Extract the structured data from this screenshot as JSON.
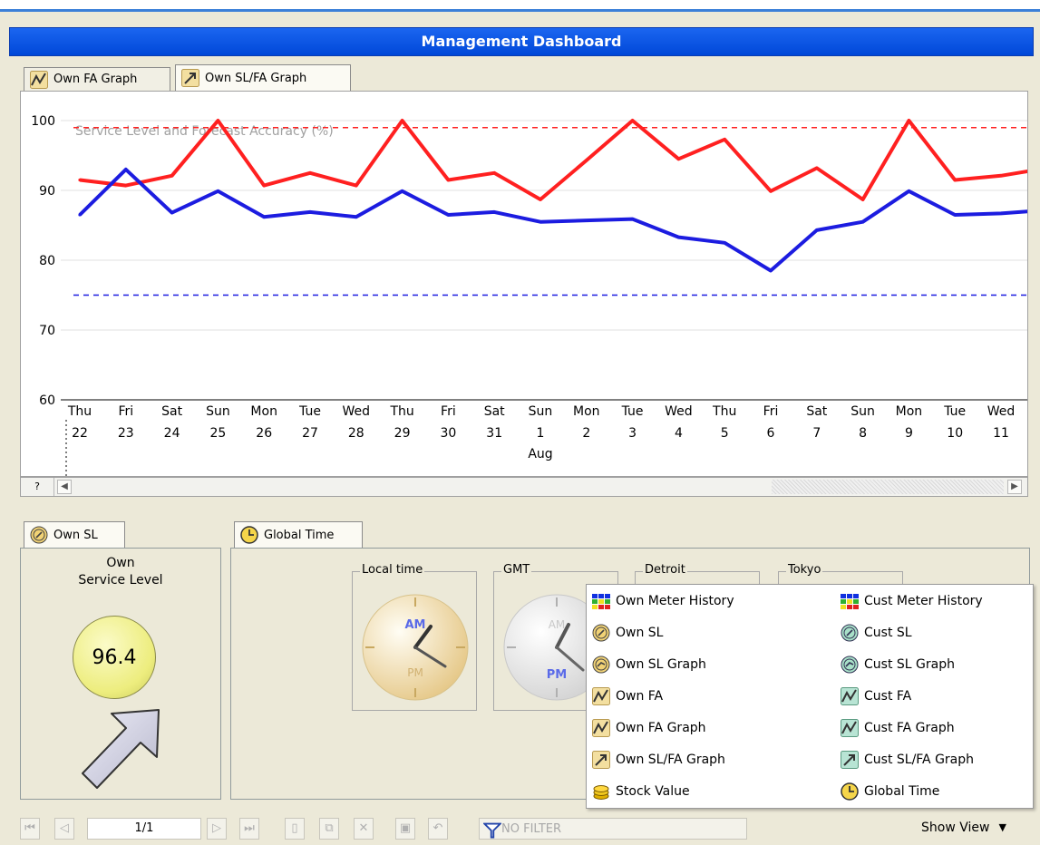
{
  "window": {
    "title": "Management Dashboard"
  },
  "top_tabs": [
    {
      "label": "Own FA Graph",
      "icon": "own-fa-graph-icon"
    },
    {
      "label": "Own SL/FA Graph",
      "icon": "own-slfa-graph-icon"
    }
  ],
  "chart": {
    "help_label": "?"
  },
  "chart_data": {
    "type": "line",
    "title": "Service Level and Forecast Accuracy (%)",
    "xlabel": "",
    "ylabel": "",
    "ylim": [
      60,
      100
    ],
    "yticks": [
      60,
      70,
      80,
      90,
      100
    ],
    "grid": true,
    "categories": [
      "Thu 22",
      "Fri 23",
      "Sat 24",
      "Sun 25",
      "Mon 26",
      "Tue 27",
      "Wed 28",
      "Thu 29",
      "Fri 30",
      "Sat 31",
      "Sun 1",
      "Mon 2",
      "Tue 3",
      "Wed 4",
      "Thu 5",
      "Fri 6",
      "Sat 7",
      "Sun 8",
      "Mon 9",
      "Tue 10",
      "Wed 11"
    ],
    "x_days": [
      "Thu",
      "Fri",
      "Sat",
      "Sun",
      "Mon",
      "Tue",
      "Wed",
      "Thu",
      "Fri",
      "Sat",
      "Sun",
      "Mon",
      "Tue",
      "Wed",
      "Thu",
      "Fri",
      "Sat",
      "Sun",
      "Mon",
      "Tue",
      "Wed"
    ],
    "x_dates": [
      "22",
      "23",
      "24",
      "25",
      "26",
      "27",
      "28",
      "29",
      "30",
      "31",
      "1",
      "2",
      "3",
      "4",
      "5",
      "6",
      "7",
      "8",
      "9",
      "10",
      "11"
    ],
    "month_label": "Aug",
    "series": [
      {
        "color": "#ff2020",
        "values": [
          91.5,
          90.7,
          92.1,
          100,
          90.7,
          92.5,
          90.7,
          100,
          91.5,
          92.5,
          88.7,
          94.3,
          100,
          94.5,
          97.3,
          89.9,
          93.2,
          88.7,
          100,
          91.5,
          92.1,
          93.2
        ]
      },
      {
        "color": "#1c1ce0",
        "values": [
          86.5,
          93.0,
          86.8,
          89.9,
          86.2,
          86.9,
          86.2,
          89.9,
          86.5,
          86.9,
          85.5,
          85.7,
          85.9,
          83.3,
          82.5,
          78.5,
          84.3,
          85.5,
          89.9,
          86.5,
          86.7,
          87.2
        ]
      }
    ],
    "reference_lines": [
      {
        "value": 99,
        "color": "#ff2020",
        "style": "dashed"
      },
      {
        "value": 75,
        "color": "#1c1ce0",
        "style": "dashed"
      }
    ]
  },
  "left_panel": {
    "tab_label": "Own SL",
    "label_line1": "Own",
    "label_line2": "Service Level",
    "value": "96.4",
    "indicator_color": "#f1f17a",
    "trend": "up"
  },
  "global_time": {
    "tab_label": "Global Time",
    "clocks": [
      {
        "label": "Local time"
      },
      {
        "label": "GMT"
      },
      {
        "label": "Detroit"
      },
      {
        "label": "Tokyo"
      }
    ],
    "am_label": "AM",
    "pm_label": "PM"
  },
  "show_view_menu": {
    "left_items": [
      {
        "label": "Own Meter History",
        "icon": "meter-history-icon"
      },
      {
        "label": "Own SL",
        "icon": "own-sl-icon"
      },
      {
        "label": "Own SL Graph",
        "icon": "own-sl-graph-icon"
      },
      {
        "label": "Own FA",
        "icon": "own-fa-icon"
      },
      {
        "label": "Own FA Graph",
        "icon": "own-fa-graph-icon"
      },
      {
        "label": "Own SL/FA Graph",
        "icon": "own-slfa-graph-icon"
      },
      {
        "label": "Stock Value",
        "icon": "stock-value-icon"
      }
    ],
    "right_items": [
      {
        "label": "Cust Meter History",
        "icon": "meter-history-icon"
      },
      {
        "label": "Cust SL",
        "icon": "cust-sl-icon"
      },
      {
        "label": "Cust SL Graph",
        "icon": "cust-sl-graph-icon"
      },
      {
        "label": "Cust FA",
        "icon": "cust-fa-icon"
      },
      {
        "label": "Cust FA Graph",
        "icon": "cust-fa-graph-icon"
      },
      {
        "label": "Cust SL/FA Graph",
        "icon": "cust-slfa-graph-icon"
      },
      {
        "label": "Global Time",
        "icon": "global-time-icon"
      }
    ]
  },
  "toolbar": {
    "page_indicator": "1/1",
    "filter_text": "NO FILTER",
    "show_view_label": "Show View"
  }
}
